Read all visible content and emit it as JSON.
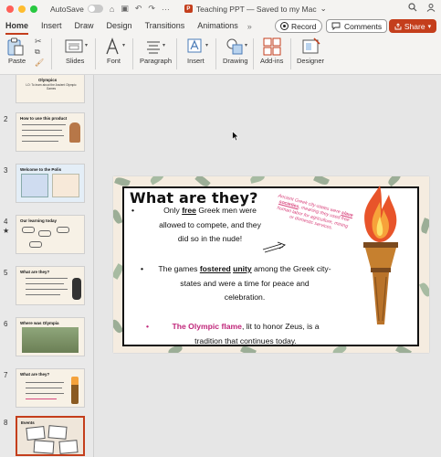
{
  "titlebar": {
    "autosave_label": "AutoSave",
    "doc_title": "Teaching PPT — Saved to my Mac",
    "doc_title_chevron": "⌄",
    "app_icon_letter": "P"
  },
  "tabs": {
    "items": [
      "Home",
      "Insert",
      "Draw",
      "Design",
      "Transitions",
      "Animations"
    ],
    "more": "»",
    "record_label": "Record",
    "comments_label": "Comments",
    "share_label": "Share"
  },
  "ribbon": {
    "paste": "Paste",
    "slides": "Slides",
    "font": "Font",
    "paragraph": "Paragraph",
    "insert": "Insert",
    "drawing": "Drawing",
    "addins": "Add-ins",
    "designer": "Designer"
  },
  "thumbnails": [
    {
      "num": "",
      "title": "Olympics",
      "subtitle": "LO: To learn about the Ancient Olympic Games"
    },
    {
      "num": "2",
      "title": "How to use this product"
    },
    {
      "num": "3",
      "title": "Welcome to the Polis"
    },
    {
      "num": "4",
      "title": "Our learning today"
    },
    {
      "num": "5",
      "title": "What are they?"
    },
    {
      "num": "6",
      "title": "Where was Olympia"
    },
    {
      "num": "7",
      "title": "What are they?"
    },
    {
      "num": "8",
      "title": "Events"
    }
  ],
  "slide": {
    "title": "What are they?",
    "note": {
      "pre": "Ancient Greek city-states were ",
      "underlined": "slave societies",
      "post": ", meaning they used free human labor for agriculture, mining or domestic services."
    },
    "bullet1": {
      "a": "Only ",
      "b": "free",
      "c": " Greek men were",
      "line2": "allowed to compete, and they",
      "line3": "did so in the nude!"
    },
    "bullet2": {
      "a": "The games ",
      "b": "fostered",
      "c": " ",
      "d": "unity",
      "e": " among the Greek city-",
      "line2": "states and were a time for peace and",
      "line3": "celebration."
    },
    "bullet3": {
      "pink": "The Olympic flame",
      "rest": ", lit to honor Zeus, is a",
      "line2": "tradition that continues today."
    }
  },
  "colors": {
    "accent": "#c43e1c",
    "pink_text": "#c0267a",
    "note_pink": "#d9487f"
  }
}
